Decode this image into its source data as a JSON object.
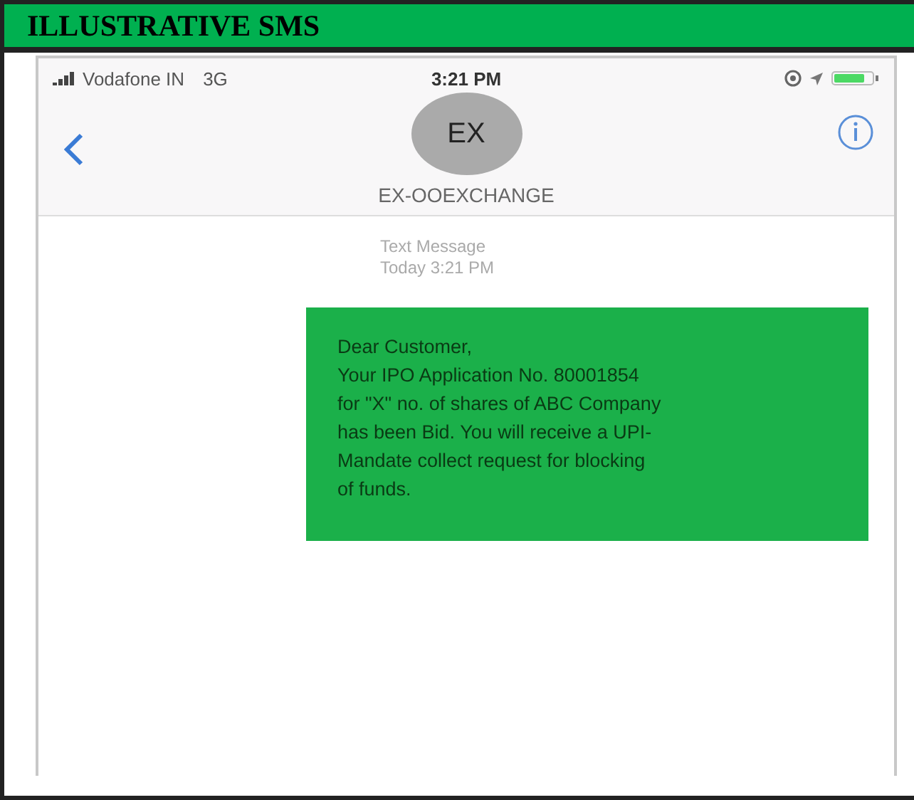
{
  "header": {
    "title": "ILLUSTRATIVE SMS"
  },
  "status_bar": {
    "carrier": "Vodafone IN",
    "network": "3G",
    "time": "3:21 PM"
  },
  "contact": {
    "initials": "EX",
    "name": "EX-OOEXCHANGE"
  },
  "thread": {
    "label": "Text Message",
    "timestamp": "Today 3:21 PM"
  },
  "message": {
    "lines": [
      "Dear Customer,",
      "Your IPO Application No. 80001854",
      "for \"X\" no. of shares of ABC Company",
      "has been Bid. You will receive a UPI-",
      "Mandate collect request for blocking",
      "of funds."
    ]
  }
}
